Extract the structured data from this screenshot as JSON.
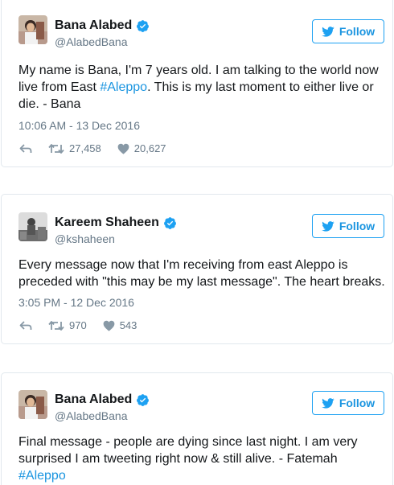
{
  "tweets": [
    {
      "name": "Bana Alabed",
      "handle": "@AlabedBana",
      "follow_label": "Follow",
      "text_before": "My name is Bana, I'm 7 years old. I am talking to the world now live from East ",
      "hashtag": "#Aleppo",
      "text_after": ". This is my last moment to either live or die. - Bana",
      "timestamp": "10:06 AM - 13 Dec 2016",
      "retweets": "27,458",
      "likes": "20,627"
    },
    {
      "name": "Kareem Shaheen",
      "handle": "@kshaheen",
      "follow_label": "Follow",
      "text": "Every message now that I'm receiving from east Aleppo is preceded with \"this may be my last message\". The heart breaks.",
      "timestamp": "3:05 PM - 12 Dec 2016",
      "retweets": "970",
      "likes": "543"
    },
    {
      "name": "Bana Alabed",
      "handle": "@AlabedBana",
      "follow_label": "Follow",
      "text": "Final message - people are dying since last night. I am very surprised I am tweeting right now & still alive. - Fatemah",
      "hashtag": "#Aleppo"
    }
  ],
  "icons": {
    "verified": "verified-badge-icon",
    "follow": "twitter-bird-icon",
    "reply": "reply-icon",
    "retweet": "retweet-icon",
    "like": "heart-icon"
  },
  "colors": {
    "accent": "#1da1f2",
    "link": "#1b95e0",
    "muted": "#657786",
    "border": "#e1e8ed"
  }
}
